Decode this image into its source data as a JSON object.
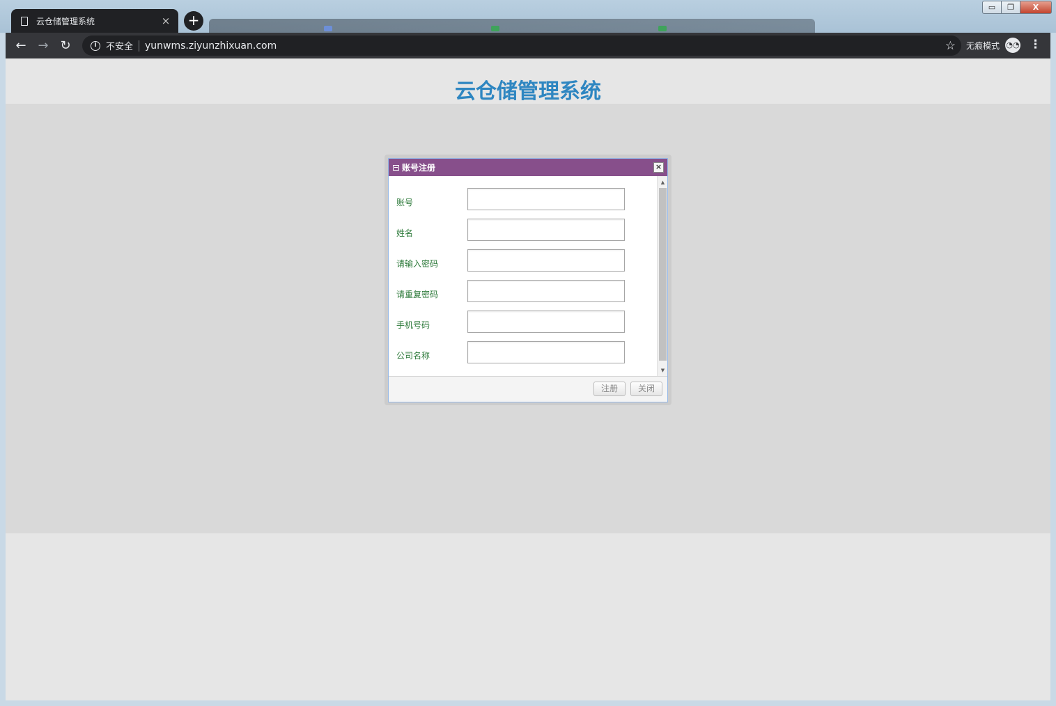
{
  "browser": {
    "tab_title": "云仓储管理系统",
    "tab_close": "×",
    "new_tab": "+",
    "security_label": "不安全",
    "url": "yunwms.ziyunzhixuan.com",
    "incognito_label": "无痕模式",
    "window_controls": {
      "minimize": "▭",
      "maximize": "❐",
      "close": "X"
    }
  },
  "page": {
    "title": "云仓储管理系统"
  },
  "dialog": {
    "title": "账号注册",
    "close_symbol": "×",
    "fields": [
      {
        "label": "账号",
        "value": ""
      },
      {
        "label": "姓名",
        "value": ""
      },
      {
        "label": "请输入密码",
        "value": ""
      },
      {
        "label": "请重复密码",
        "value": ""
      },
      {
        "label": "手机号码",
        "value": ""
      },
      {
        "label": "公司名称",
        "value": ""
      }
    ],
    "buttons": {
      "register": "注册",
      "close": "关闭"
    }
  },
  "colors": {
    "title_blue": "#2e86c1",
    "dialog_header": "#874f8b",
    "label_green": "#2d7a3a"
  }
}
